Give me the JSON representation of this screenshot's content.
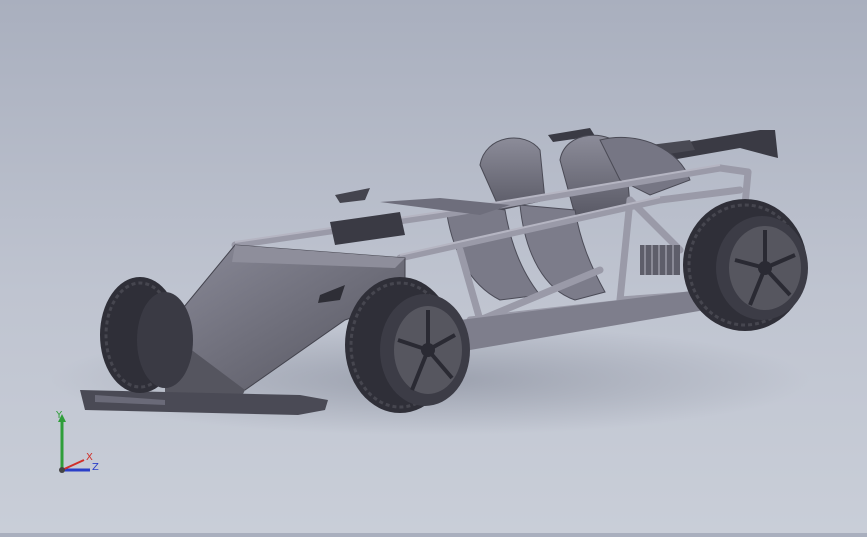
{
  "viewport": {
    "model": "race-car-chassis-assembly",
    "view": "isometric-shaded"
  },
  "triad": {
    "x_label": "X",
    "y_label": "Y",
    "z_label": "Z",
    "x_color": "#d0302a",
    "y_color": "#2f9e3a",
    "z_color": "#2a3fc8"
  },
  "colors": {
    "background_top": "#a9afbe",
    "background_bottom": "#c9ced8",
    "body": "#6e6e7c",
    "tube": "#9a9aa8",
    "tire": "#2f2f38",
    "rim": "#55555f"
  }
}
